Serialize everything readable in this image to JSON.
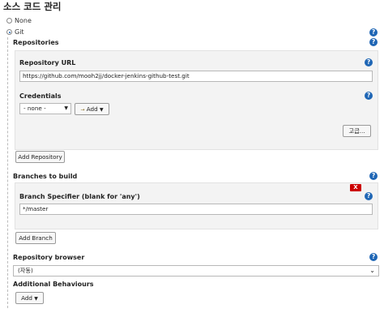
{
  "section_title": "소스 코드 관리",
  "scm_options": [
    {
      "label": "None",
      "checked": false
    },
    {
      "label": "Git",
      "checked": true
    }
  ],
  "repositories": {
    "heading": "Repositories",
    "url_label": "Repository URL",
    "url_value": "https://github.com/mooh2jj/docker-jenkins-github-test.git",
    "credentials_label": "Credentials",
    "credentials_selected": "- none -",
    "add_button": "Add",
    "advanced_button": "고급...",
    "add_repository_button": "Add Repository"
  },
  "branches": {
    "heading": "Branches to build",
    "delete_button": "X",
    "specifier_label": "Branch Specifier (blank for 'any')",
    "specifier_value": "*/master",
    "add_branch_button": "Add Branch"
  },
  "browser": {
    "label": "Repository browser",
    "selected": "(자동)"
  },
  "behaviours": {
    "heading": "Additional Behaviours",
    "add_button": "Add"
  },
  "help_icon_glyph": "?",
  "colors": {
    "help_blue": "#1f66b5",
    "delete_red": "#cc0000",
    "panel_bg": "#f3f3f3"
  }
}
